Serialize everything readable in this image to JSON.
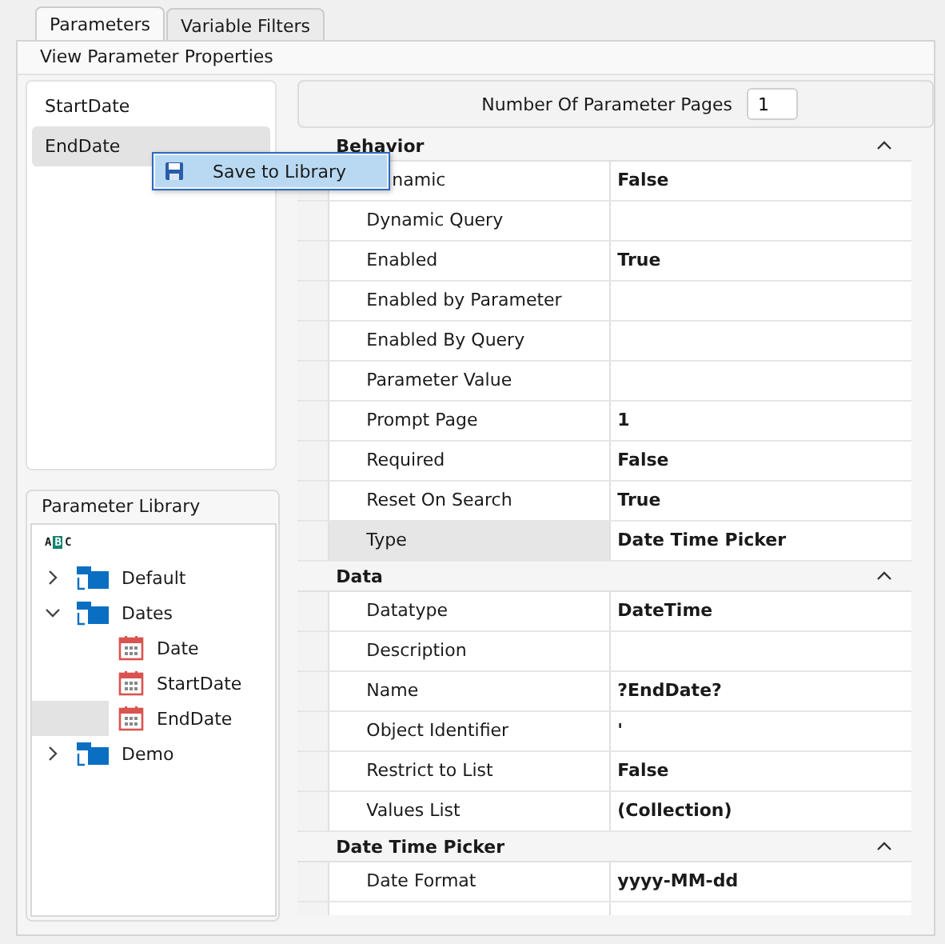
{
  "tabs": [
    {
      "label": "Parameters",
      "selected": true
    },
    {
      "label": "Variable Filters",
      "selected": false
    }
  ],
  "group_title": "View Parameter Properties",
  "parameters": [
    {
      "label": "StartDate",
      "selected": false
    },
    {
      "label": "EndDate",
      "selected": true
    }
  ],
  "context_menu": {
    "items": [
      {
        "label": "Save to Library",
        "selected": true
      }
    ]
  },
  "library": {
    "title": "Parameter Library",
    "sort_icon_text": "ABC",
    "tree": [
      {
        "label": "Default",
        "kind": "folder",
        "expanded": false,
        "selected": false
      },
      {
        "label": "Dates",
        "kind": "folder",
        "expanded": true,
        "selected": false,
        "children": [
          {
            "label": "Date",
            "kind": "date",
            "selected": false
          },
          {
            "label": "StartDate",
            "kind": "date",
            "selected": false
          },
          {
            "label": "EndDate",
            "kind": "date",
            "selected": true
          }
        ]
      },
      {
        "label": "Demo",
        "kind": "folder",
        "expanded": false,
        "selected": false
      }
    ]
  },
  "page_count": {
    "label": "Number Of Parameter Pages",
    "value": "1"
  },
  "properties": [
    {
      "title": "Behavior",
      "expanded": true,
      "rows": [
        {
          "label": "namic",
          "value": "False",
          "covered": true,
          "selected": false
        },
        {
          "label": "Dynamic Query",
          "selected": false
        },
        {
          "label": "Enabled",
          "value": "True",
          "selected": false
        },
        {
          "label": "Enabled by Parameter",
          "selected": false
        },
        {
          "label": "Enabled By Query",
          "selected": false
        },
        {
          "label": "Parameter Value",
          "selected": false
        },
        {
          "label": "Prompt Page",
          "value": "1",
          "selected": false
        },
        {
          "label": "Required",
          "value": "False",
          "selected": false
        },
        {
          "label": "Reset On Search",
          "value": "True",
          "selected": false
        },
        {
          "label": "Type",
          "value": "Date Time Picker",
          "selected": true
        }
      ]
    },
    {
      "title": "Data",
      "expanded": true,
      "rows": [
        {
          "label": "Datatype",
          "value": "DateTime",
          "selected": false
        },
        {
          "label": "Description",
          "selected": false
        },
        {
          "label": "Name",
          "value": "?EndDate?",
          "selected": false
        },
        {
          "label": "Object Identifier",
          "value": "'",
          "selected": false
        },
        {
          "label": "Restrict to List",
          "value": "False",
          "selected": false
        },
        {
          "label": "Values List",
          "value": "(Collection)",
          "selected": false
        }
      ]
    },
    {
      "title": "Date Time Picker",
      "expanded": true,
      "rows": [
        {
          "label": "Date Format",
          "value": "yyyy-MM-dd",
          "selected": false
        }
      ],
      "partial_row": true
    }
  ]
}
